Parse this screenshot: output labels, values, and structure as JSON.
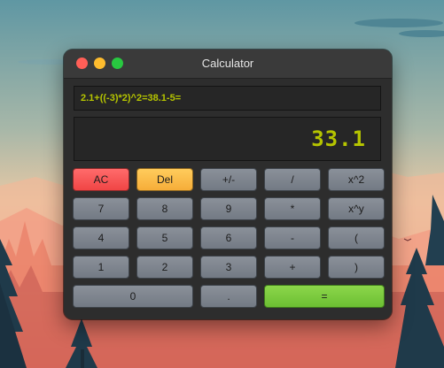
{
  "window": {
    "title": "Calculator"
  },
  "expression": "2.1+((-3)*2)^2=38.1-5=",
  "display": "33.1",
  "keypad": {
    "rows": [
      [
        {
          "label": "AC",
          "kind": "ac"
        },
        {
          "label": "Del",
          "kind": "del"
        },
        {
          "label": "+/-"
        },
        {
          "label": "/"
        },
        {
          "label": "x^2"
        }
      ],
      [
        {
          "label": "7"
        },
        {
          "label": "8"
        },
        {
          "label": "9"
        },
        {
          "label": "*"
        },
        {
          "label": "x^y"
        }
      ],
      [
        {
          "label": "4"
        },
        {
          "label": "5"
        },
        {
          "label": "6"
        },
        {
          "label": "-"
        },
        {
          "label": "("
        }
      ],
      [
        {
          "label": "1"
        },
        {
          "label": "2"
        },
        {
          "label": "3"
        },
        {
          "label": "+"
        },
        {
          "label": ")"
        }
      ],
      [
        {
          "label": "0",
          "span": 2
        },
        {
          "label": "."
        },
        {
          "label": "=",
          "kind": "eq",
          "span": 2
        }
      ]
    ]
  },
  "colors": {
    "close": "#ff5f57",
    "minimize": "#febc2e",
    "maximize": "#28c840",
    "display_text": "#b5c400",
    "ac": "#f04545",
    "del": "#f6ad39",
    "equals": "#6cbf33"
  }
}
